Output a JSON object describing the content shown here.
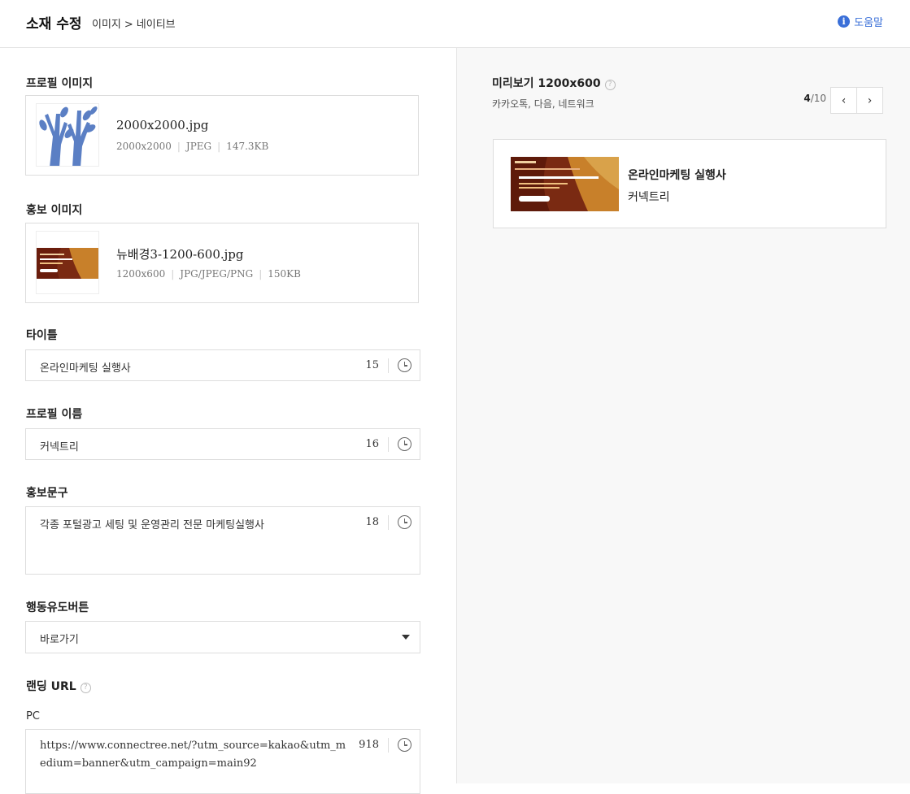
{
  "header": {
    "title": "소재 수정",
    "breadcrumb": [
      "이미지",
      "네이티브"
    ],
    "breadcrumb_sep": ">",
    "help_label": "도움말",
    "help_icon": "info-icon",
    "accent_color": "#3a6fd8"
  },
  "form": {
    "profile_image": {
      "label": "프로필 이미지",
      "filename": "2000x2000.jpg",
      "meta": [
        "2000x2000",
        "JPEG",
        "147.3KB"
      ]
    },
    "promo_image": {
      "label": "홍보 이미지",
      "filename": "뉴배경3-1200-600.jpg",
      "meta": [
        "1200x600",
        "JPG/JPEG/PNG",
        "150KB"
      ]
    },
    "title_field": {
      "label": "타이틀",
      "value": "온라인마케팅 실행사",
      "count": "15"
    },
    "profile_name_field": {
      "label": "프로필 이름",
      "value": "커넥트리",
      "count": "16"
    },
    "promo_text_field": {
      "label": "홍보문구",
      "value": "각종 포털광고 세팅 및 운영관리 전문 마케팅실행사",
      "count": "18"
    },
    "cta": {
      "label": "행동유도버튼",
      "selected": "바로가기"
    },
    "landing_url": {
      "label": "랜딩 URL",
      "pc_label": "PC",
      "value": "https://www.connectree.net/?utm_source=kakao&utm_medium=banner&utm_campaign=main92",
      "count": "918"
    }
  },
  "preview": {
    "title": "미리보기 1200x600",
    "subtitle": "카카오톡, 다음, 네트워크",
    "page_current": "4",
    "page_total": "/10",
    "prev_icon": "chevron-left-icon",
    "next_icon": "chevron-right-icon",
    "card_title": "온라인마케팅 실행사",
    "card_name": "커넥트리"
  }
}
